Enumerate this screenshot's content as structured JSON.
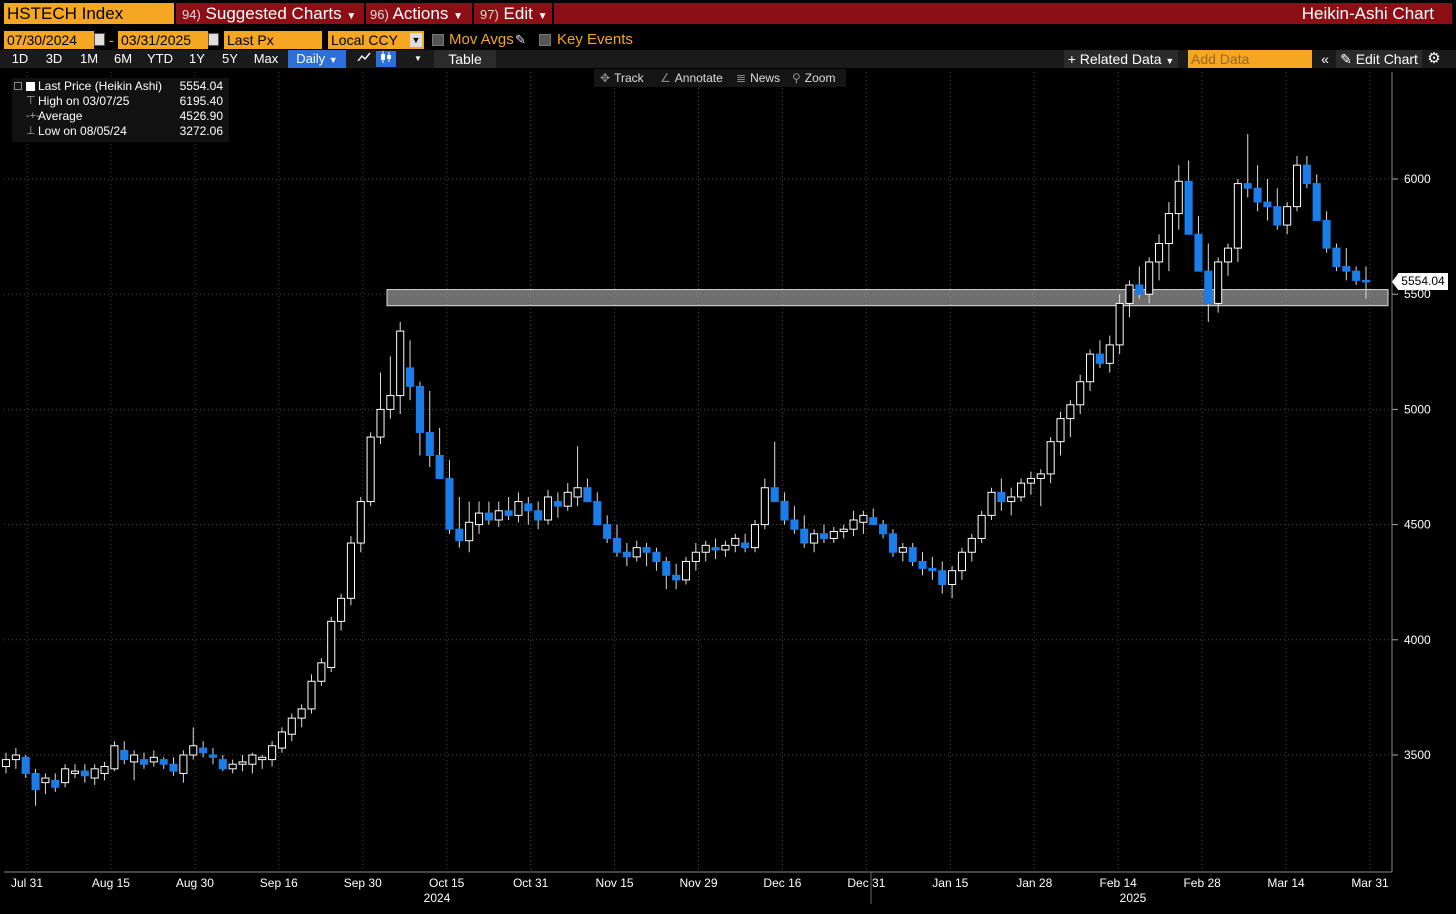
{
  "toolbar": {
    "ticker": "HSTECH Index",
    "menu": [
      {
        "num": "94)",
        "label": "Suggested Charts"
      },
      {
        "num": "96)",
        "label": "Actions"
      },
      {
        "num": "97)",
        "label": "Edit"
      }
    ],
    "chart_type_title": "Heikin-Ashi Chart"
  },
  "settings": {
    "start_date": "07/30/2024",
    "end_date": "03/31/2025",
    "field": "Last Px",
    "currency": "Local CCY",
    "mov_avgs": "Mov Avgs",
    "key_events": "Key Events"
  },
  "ranges": [
    "1D",
    "3D",
    "1M",
    "6M",
    "YTD",
    "1Y",
    "5Y",
    "Max"
  ],
  "frequency": "Daily",
  "buttons": {
    "table": "Table",
    "related": "Related Data",
    "add_data_placeholder": "Add Data",
    "edit_chart": "Edit Chart"
  },
  "tools": [
    "Track",
    "Annotate",
    "News",
    "Zoom"
  ],
  "legend": {
    "series_label": "Last Price (Heikin Ashi)",
    "last_value": "5554.04",
    "high_label": "High on 03/07/25",
    "high_value": "6195.40",
    "avg_label": "Average",
    "avg_value": "4526.90",
    "low_label": "Low on 08/05/24",
    "low_value": "3272.06"
  },
  "colors": {
    "up": "#ffffff",
    "down": "#1a7de8",
    "accent": "#f5a623",
    "titlebar": "#8b0f15"
  },
  "chart_data": {
    "type": "candlestick",
    "ylim": [
      3000,
      6400
    ],
    "yticks": [
      3500,
      4000,
      4500,
      5000,
      5500,
      6000
    ],
    "x_labels": [
      "Jul 31",
      "Aug 15",
      "Aug 30",
      "Sep 16",
      "Sep 30",
      "Oct 15",
      "Oct 31",
      "Nov 15",
      "Nov 29",
      "Dec 16",
      "Dec 31",
      "Jan 15",
      "Jan 28",
      "Feb 14",
      "Feb 28",
      "Mar 14",
      "Mar 31"
    ],
    "year_labels": [
      "2024",
      "2025"
    ],
    "last_price_label": "5554.04",
    "resistance_band": [
      5450,
      5520
    ],
    "candles": [
      [
        3450,
        3510,
        3420,
        3480
      ],
      [
        3480,
        3530,
        3440,
        3500
      ],
      [
        3490,
        3500,
        3400,
        3420
      ],
      [
        3420,
        3440,
        3280,
        3350
      ],
      [
        3380,
        3420,
        3330,
        3400
      ],
      [
        3390,
        3420,
        3340,
        3360
      ],
      [
        3380,
        3460,
        3360,
        3440
      ],
      [
        3420,
        3460,
        3400,
        3430
      ],
      [
        3430,
        3460,
        3380,
        3410
      ],
      [
        3400,
        3460,
        3370,
        3440
      ],
      [
        3420,
        3470,
        3390,
        3450
      ],
      [
        3440,
        3560,
        3430,
        3540
      ],
      [
        3520,
        3560,
        3460,
        3480
      ],
      [
        3470,
        3520,
        3390,
        3500
      ],
      [
        3480,
        3510,
        3440,
        3460
      ],
      [
        3470,
        3520,
        3450,
        3490
      ],
      [
        3480,
        3490,
        3440,
        3460
      ],
      [
        3460,
        3490,
        3410,
        3430
      ],
      [
        3420,
        3520,
        3380,
        3500
      ],
      [
        3500,
        3620,
        3480,
        3540
      ],
      [
        3530,
        3560,
        3490,
        3510
      ],
      [
        3500,
        3530,
        3460,
        3490
      ],
      [
        3480,
        3500,
        3430,
        3440
      ],
      [
        3440,
        3480,
        3420,
        3460
      ],
      [
        3460,
        3500,
        3430,
        3470
      ],
      [
        3460,
        3510,
        3420,
        3500
      ],
      [
        3480,
        3500,
        3440,
        3490
      ],
      [
        3480,
        3560,
        3450,
        3540
      ],
      [
        3530,
        3620,
        3510,
        3600
      ],
      [
        3590,
        3680,
        3560,
        3660
      ],
      [
        3660,
        3720,
        3620,
        3700
      ],
      [
        3700,
        3850,
        3680,
        3820
      ],
      [
        3820,
        3920,
        3800,
        3900
      ],
      [
        3880,
        4100,
        3860,
        4080
      ],
      [
        4080,
        4200,
        4040,
        4180
      ],
      [
        4180,
        4450,
        4150,
        4420
      ],
      [
        4420,
        4620,
        4380,
        4600
      ],
      [
        4600,
        4900,
        4580,
        4880
      ],
      [
        4880,
        5160,
        4850,
        5000
      ],
      [
        5000,
        5230,
        4960,
        5060
      ],
      [
        5060,
        5380,
        4980,
        5340
      ],
      [
        5180,
        5300,
        5040,
        5100
      ],
      [
        5100,
        5120,
        4800,
        4900
      ],
      [
        4900,
        5080,
        4750,
        4800
      ],
      [
        4800,
        4920,
        4700,
        4700
      ],
      [
        4700,
        4780,
        4460,
        4480
      ],
      [
        4480,
        4620,
        4400,
        4430
      ],
      [
        4430,
        4600,
        4380,
        4510
      ],
      [
        4500,
        4600,
        4460,
        4550
      ],
      [
        4550,
        4600,
        4500,
        4520
      ],
      [
        4520,
        4600,
        4490,
        4560
      ],
      [
        4560,
        4620,
        4520,
        4540
      ],
      [
        4540,
        4640,
        4510,
        4600
      ],
      [
        4590,
        4620,
        4500,
        4560
      ],
      [
        4560,
        4600,
        4480,
        4520
      ],
      [
        4520,
        4650,
        4500,
        4620
      ],
      [
        4600,
        4640,
        4530,
        4580
      ],
      [
        4580,
        4680,
        4560,
        4640
      ],
      [
        4620,
        4840,
        4580,
        4660
      ],
      [
        4660,
        4700,
        4620,
        4600
      ],
      [
        4600,
        4640,
        4500,
        4500
      ],
      [
        4500,
        4540,
        4420,
        4440
      ],
      [
        4440,
        4500,
        4360,
        4380
      ],
      [
        4380,
        4420,
        4320,
        4360
      ],
      [
        4360,
        4430,
        4340,
        4400
      ],
      [
        4400,
        4420,
        4320,
        4380
      ],
      [
        4380,
        4400,
        4300,
        4340
      ],
      [
        4340,
        4360,
        4220,
        4280
      ],
      [
        4280,
        4330,
        4220,
        4260
      ],
      [
        4260,
        4360,
        4240,
        4340
      ],
      [
        4340,
        4420,
        4300,
        4380
      ],
      [
        4380,
        4430,
        4340,
        4410
      ],
      [
        4400,
        4440,
        4350,
        4390
      ],
      [
        4390,
        4430,
        4360,
        4410
      ],
      [
        4410,
        4460,
        4380,
        4440
      ],
      [
        4420,
        4460,
        4380,
        4400
      ],
      [
        4400,
        4520,
        4380,
        4500
      ],
      [
        4500,
        4700,
        4480,
        4660
      ],
      [
        4660,
        4860,
        4620,
        4600
      ],
      [
        4600,
        4640,
        4500,
        4520
      ],
      [
        4520,
        4580,
        4460,
        4480
      ],
      [
        4480,
        4540,
        4400,
        4420
      ],
      [
        4420,
        4480,
        4380,
        4460
      ],
      [
        4460,
        4500,
        4420,
        4440
      ],
      [
        4440,
        4490,
        4420,
        4470
      ],
      [
        4470,
        4500,
        4440,
        4480
      ],
      [
        4480,
        4560,
        4450,
        4520
      ],
      [
        4510,
        4560,
        4460,
        4540
      ],
      [
        4530,
        4570,
        4500,
        4500
      ],
      [
        4500,
        4520,
        4440,
        4460
      ],
      [
        4460,
        4480,
        4360,
        4380
      ],
      [
        4380,
        4420,
        4340,
        4400
      ],
      [
        4400,
        4420,
        4320,
        4340
      ],
      [
        4340,
        4380,
        4280,
        4310
      ],
      [
        4310,
        4360,
        4260,
        4300
      ],
      [
        4300,
        4340,
        4200,
        4240
      ],
      [
        4240,
        4320,
        4180,
        4300
      ],
      [
        4300,
        4400,
        4260,
        4380
      ],
      [
        4380,
        4460,
        4340,
        4440
      ],
      [
        4440,
        4560,
        4420,
        4540
      ],
      [
        4540,
        4660,
        4520,
        4640
      ],
      [
        4640,
        4700,
        4560,
        4600
      ],
      [
        4600,
        4660,
        4540,
        4620
      ],
      [
        4620,
        4700,
        4600,
        4680
      ],
      [
        4680,
        4730,
        4630,
        4700
      ],
      [
        4700,
        4740,
        4580,
        4720
      ],
      [
        4720,
        4880,
        4680,
        4860
      ],
      [
        4860,
        4990,
        4800,
        4960
      ],
      [
        4960,
        5040,
        4880,
        5020
      ],
      [
        5020,
        5150,
        4980,
        5120
      ],
      [
        5120,
        5260,
        5080,
        5240
      ],
      [
        5240,
        5300,
        5180,
        5200
      ],
      [
        5200,
        5320,
        5160,
        5280
      ],
      [
        5280,
        5500,
        5240,
        5460
      ],
      [
        5460,
        5560,
        5400,
        5540
      ],
      [
        5540,
        5620,
        5480,
        5500
      ],
      [
        5500,
        5660,
        5460,
        5640
      ],
      [
        5640,
        5760,
        5560,
        5720
      ],
      [
        5720,
        5900,
        5600,
        5850
      ],
      [
        5850,
        6060,
        5780,
        5990
      ],
      [
        5990,
        6080,
        5880,
        5760
      ],
      [
        5760,
        5840,
        5600,
        5600
      ],
      [
        5600,
        5720,
        5380,
        5460
      ],
      [
        5460,
        5660,
        5420,
        5640
      ],
      [
        5640,
        5720,
        5580,
        5700
      ],
      [
        5700,
        6000,
        5640,
        5980
      ],
      [
        5980,
        6195,
        5920,
        5960
      ],
      [
        5960,
        6060,
        5860,
        5900
      ],
      [
        5900,
        6000,
        5820,
        5880
      ],
      [
        5880,
        5960,
        5780,
        5800
      ],
      [
        5800,
        5900,
        5760,
        5880
      ],
      [
        5880,
        6100,
        5860,
        6060
      ],
      [
        6060,
        6100,
        5960,
        5980
      ],
      [
        5980,
        6020,
        5820,
        5820
      ],
      [
        5820,
        5860,
        5680,
        5700
      ],
      [
        5700,
        5720,
        5600,
        5620
      ],
      [
        5620,
        5700,
        5560,
        5600
      ],
      [
        5600,
        5620,
        5540,
        5560
      ],
      [
        5560,
        5620,
        5480,
        5554.04
      ]
    ]
  }
}
